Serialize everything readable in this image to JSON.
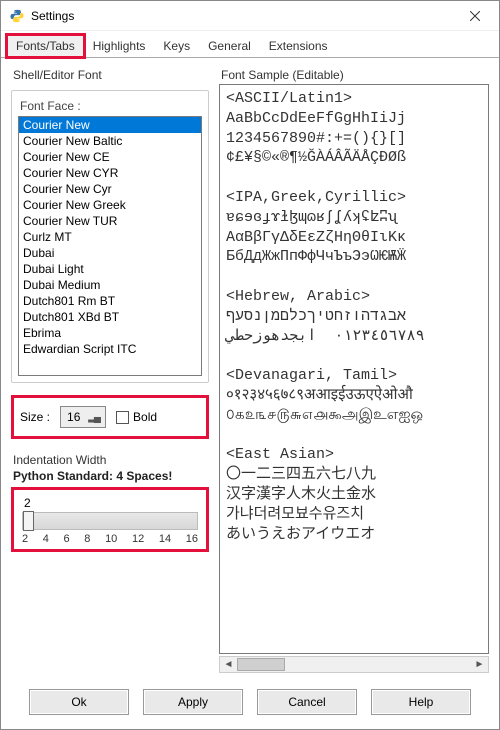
{
  "window": {
    "title": "Settings"
  },
  "tabs": {
    "items": [
      "Fonts/Tabs",
      "Highlights",
      "Keys",
      "General",
      "Extensions"
    ],
    "active_index": 0
  },
  "left_panel": {
    "group_label": "Shell/Editor Font",
    "font_face_label": "Font Face :",
    "fonts": [
      "Courier New",
      "Courier New Baltic",
      "Courier New CE",
      "Courier New CYR",
      "Courier New Cyr",
      "Courier New Greek",
      "Courier New TUR",
      "Curlz MT",
      "Dubai",
      "Dubai Light",
      "Dubai Medium",
      "Dutch801 Rm BT",
      "Dutch801 XBd BT",
      "Ebrima",
      "Edwardian Script ITC"
    ],
    "selected_font_index": 0,
    "size_label": "Size :",
    "size_value": "16",
    "bold_label": "Bold",
    "bold_checked": false,
    "indent_group_label": "Indentation Width",
    "indent_subtitle": "Python Standard: 4 Spaces!",
    "indent_value": "2",
    "indent_ticks": [
      "2",
      "4",
      "6",
      "8",
      "10",
      "12",
      "14",
      "16"
    ]
  },
  "right_panel": {
    "group_label": "Font Sample (Editable)",
    "lines": [
      "<ASCII/Latin1>",
      "AaBbCcDdEeFfGgHhIiJj",
      "1234567890#:+=(){}[]",
      "¢£¥§©«®¶½ĞÀÁÂÃÄÅÇÐØß",
      "",
      "<IPA,Greek,Cyrillic>",
      "ɐɕɘɞɟɤɫɮɰɷʁʃʆʎʞʢʫʭʯ",
      "ΑαΒβΓγΔδΕεΖζΗηΘθΙιΚκ",
      "БбДдЖжПпФфЧчЪъЭэѠѤѬӜ",
      "",
      "<Hebrew, Arabic>",
      "אבגדהוזחטיךכלםמןנסעף",
      "٠١٢٣٤٥٦٧٨٩  ابجدهوزحطي",
      "",
      "<Devanagari, Tamil>",
      "०१२३४५६७८९अआइईउऊएऐओऔ",
      "௦௧௨௩௪௫௬௭௮௯அஇஉஎஐஒ",
      "",
      "<East Asian>",
      "〇一二三四五六七八九",
      "汉字漢字人木火土金水",
      "가냐더려모뵤수유즈치",
      "あいうえおアイウエオ",
      ""
    ]
  },
  "buttons": {
    "ok": "Ok",
    "apply": "Apply",
    "cancel": "Cancel",
    "help": "Help"
  }
}
